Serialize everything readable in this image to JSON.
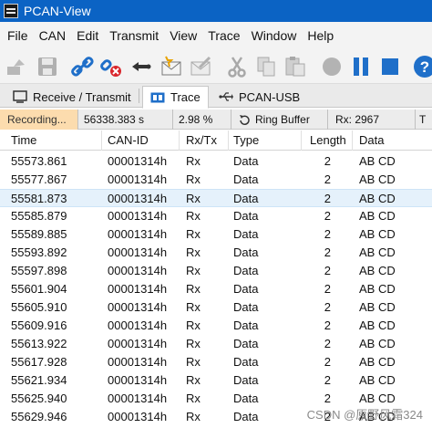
{
  "window": {
    "title": "PCAN-View"
  },
  "menu": [
    "File",
    "CAN",
    "Edit",
    "Transmit",
    "View",
    "Trace",
    "Window",
    "Help"
  ],
  "toolbar": {
    "buttons": [
      "connect-icon",
      "save-icon",
      "connect-link-icon",
      "disconnect-icon",
      "arrow-back-icon",
      "new-message-icon",
      "edit-message-icon",
      "cut-icon",
      "copy-icon",
      "paste-icon",
      "record-icon",
      "pause-icon",
      "stop-icon",
      "help-icon"
    ]
  },
  "tabs": [
    {
      "label": "Receive / Transmit",
      "icon": "receive-transmit-icon",
      "active": false
    },
    {
      "label": "Trace",
      "icon": "trace-icon",
      "active": true
    },
    {
      "label": "PCAN-USB",
      "icon": "usb-icon",
      "active": false
    }
  ],
  "status": {
    "recording": "Recording...",
    "time": "56338.383 s",
    "percent": "2.98 %",
    "buffer": "Ring Buffer",
    "rx": "Rx: 2967",
    "tx_partial": "T"
  },
  "table": {
    "columns": [
      "Time",
      "CAN-ID",
      "Rx/Tx",
      "Type",
      "Length",
      "Data"
    ],
    "rows": [
      [
        "55573.861",
        "00001314h",
        "Rx",
        "Data",
        "2",
        "AB CD"
      ],
      [
        "55577.867",
        "00001314h",
        "Rx",
        "Data",
        "2",
        "AB CD"
      ],
      [
        "55581.873",
        "00001314h",
        "Rx",
        "Data",
        "2",
        "AB CD"
      ],
      [
        "55585.879",
        "00001314h",
        "Rx",
        "Data",
        "2",
        "AB CD"
      ],
      [
        "55589.885",
        "00001314h",
        "Rx",
        "Data",
        "2",
        "AB CD"
      ],
      [
        "55593.892",
        "00001314h",
        "Rx",
        "Data",
        "2",
        "AB CD"
      ],
      [
        "55597.898",
        "00001314h",
        "Rx",
        "Data",
        "2",
        "AB CD"
      ],
      [
        "55601.904",
        "00001314h",
        "Rx",
        "Data",
        "2",
        "AB CD"
      ],
      [
        "55605.910",
        "00001314h",
        "Rx",
        "Data",
        "2",
        "AB CD"
      ],
      [
        "55609.916",
        "00001314h",
        "Rx",
        "Data",
        "2",
        "AB CD"
      ],
      [
        "55613.922",
        "00001314h",
        "Rx",
        "Data",
        "2",
        "AB CD"
      ],
      [
        "55617.928",
        "00001314h",
        "Rx",
        "Data",
        "2",
        "AB CD"
      ],
      [
        "55621.934",
        "00001314h",
        "Rx",
        "Data",
        "2",
        "AB CD"
      ],
      [
        "55625.940",
        "00001314h",
        "Rx",
        "Data",
        "2",
        "AB CD"
      ],
      [
        "55629.946",
        "00001314h",
        "Rx",
        "Data",
        "2",
        "AB CD"
      ]
    ],
    "selected_row": 2
  },
  "watermark": "CSDN @原野风霜324",
  "colors": {
    "titlebar": "#0b63c4",
    "recording_bg": "#fcdcae",
    "selected_row": "#e5f1fb",
    "accent": "#1f6fc9"
  }
}
